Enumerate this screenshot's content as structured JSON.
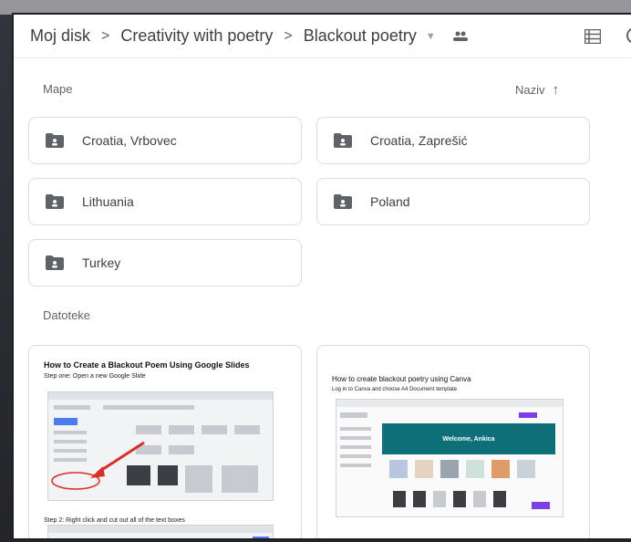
{
  "breadcrumb": {
    "root": "Moj disk",
    "parent": "Creativity with poetry",
    "current": "Blackout poetry",
    "separator": ">"
  },
  "sections": {
    "folders_label": "Mape",
    "files_label": "Datoteke",
    "sort_label": "Naziv"
  },
  "folders": [
    {
      "name": "Croatia, Vrbovec"
    },
    {
      "name": "Croatia, Zaprešić"
    },
    {
      "name": "Lithuania"
    },
    {
      "name": "Poland"
    },
    {
      "name": "Turkey"
    }
  ],
  "files": [
    {
      "thumb_title": "How to Create a Blackout Poem Using Google Slides",
      "thumb_step1": "Step one: Open a new Google Slide",
      "thumb_step2": "Step 2: Right click and cut out all of the text boxes"
    },
    {
      "thumb_title": "How to create blackout poetry using Canva",
      "thumb_sub": "Log in to Canva and choose A4 Document template",
      "banner_text": "Welcome, Ankica"
    }
  ],
  "colors": {
    "accent_blue": "#4b7bec",
    "border": "#dadce0",
    "text": "#3c4043"
  }
}
